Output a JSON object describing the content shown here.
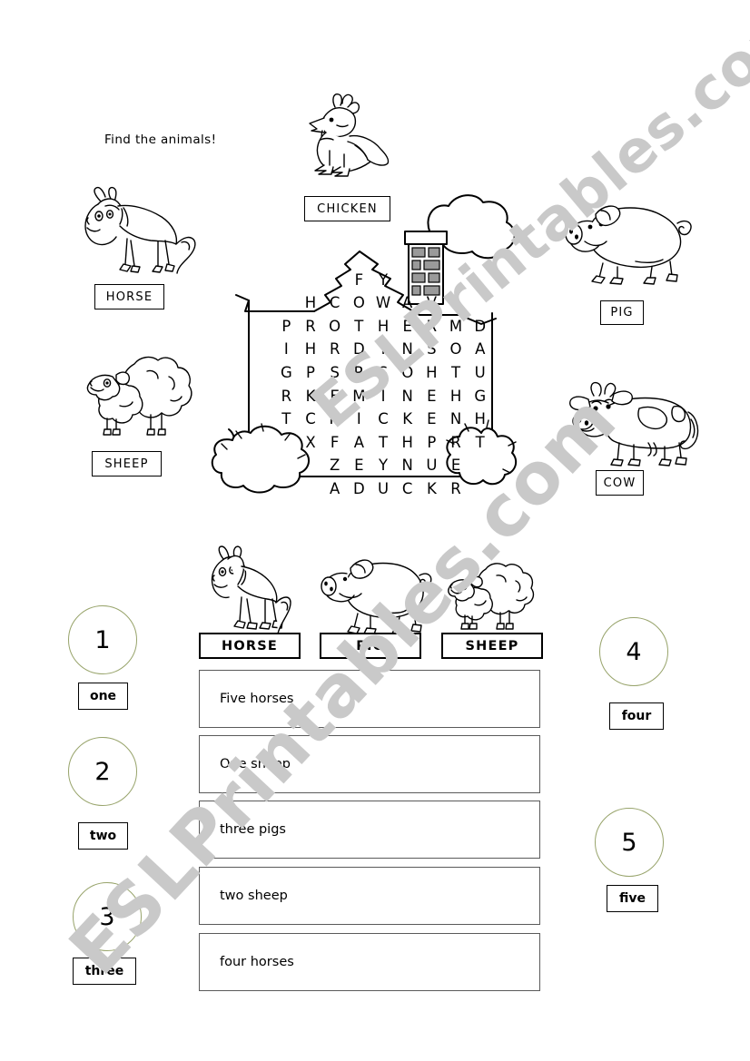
{
  "page": {
    "title": "Find the animals!",
    "watermark": "ESLPrintables.com",
    "background": "#ffffff",
    "circle_color": "#97a36a"
  },
  "animal_labels": {
    "horse": "HORSE",
    "sheep": "SHEEP",
    "chicken": "CHICKEN",
    "pig": "PIG",
    "cow": "COW"
  },
  "wordsearch": {
    "rows": [
      [
        "",
        "",
        "",
        "F",
        "Y",
        "",
        "",
        "",
        ""
      ],
      [
        "",
        "H",
        "C",
        "O",
        "W",
        "A",
        "V",
        "",
        ""
      ],
      [
        "P",
        "R",
        "O",
        "T",
        "H",
        "E",
        "R",
        "M",
        "D"
      ],
      [
        "I",
        "H",
        "R",
        "D",
        "I",
        "N",
        "S",
        "O",
        "A"
      ],
      [
        "G",
        "P",
        "S",
        "R",
        "S",
        "O",
        "H",
        "T",
        "U"
      ],
      [
        "R",
        "K",
        "E",
        "M",
        "I",
        "N",
        "E",
        "H",
        "G"
      ],
      [
        "T",
        "C",
        "H",
        "I",
        "C",
        "K",
        "E",
        "N",
        "H"
      ],
      [
        "",
        "X",
        "F",
        "A",
        "T",
        "H",
        "P",
        "R",
        "T"
      ],
      [
        "",
        "",
        "Z",
        "E",
        "Y",
        "N",
        "U",
        "E",
        ""
      ],
      [
        "",
        "",
        "A",
        "D",
        "U",
        "C",
        "K",
        "R",
        ""
      ]
    ],
    "hidden_words": [
      "COW",
      "HORSE",
      "CHICKEN",
      "PIG",
      "SHEEP",
      "DUCK"
    ]
  },
  "numbers": [
    {
      "digit": "1",
      "word": "one"
    },
    {
      "digit": "2",
      "word": "two"
    },
    {
      "digit": "3",
      "word": "three"
    },
    {
      "digit": "4",
      "word": "four"
    },
    {
      "digit": "5",
      "word": "five"
    }
  ],
  "bottom_labels": {
    "horse": "HORSE",
    "pig": "PIG",
    "sheep": "SHEEP"
  },
  "sentences": [
    {
      "text": "Five horses"
    },
    {
      "text": "One sheep"
    },
    {
      "text": "three pigs"
    },
    {
      "text": "two sheep"
    },
    {
      "text": "four horses"
    }
  ]
}
